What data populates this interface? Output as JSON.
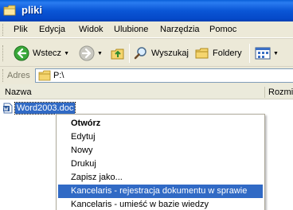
{
  "window": {
    "title": "pliki",
    "title_icon": "folder-icon"
  },
  "menubar": {
    "items": [
      "Plik",
      "Edycja",
      "Widok",
      "Ulubione",
      "Narzędzia",
      "Pomoc"
    ]
  },
  "toolbar": {
    "back_label": "Wstecz",
    "search_label": "Wyszukaj",
    "folders_label": "Foldery"
  },
  "address": {
    "label": "Adres",
    "value": "P:\\"
  },
  "columns": {
    "name": "Nazwa",
    "size": "Rozmiar"
  },
  "file": {
    "name": "Word2003.doc",
    "icon": "word-document-icon"
  },
  "context_menu": {
    "items": [
      "Otwórz",
      "Edytuj",
      "Nowy",
      "Drukuj",
      "Zapisz jako...",
      "Kancelaris - rejestracja dokumentu w sprawie",
      "Kancelaris - umieść w bazie wiedzy"
    ],
    "default_item": "Otwórz",
    "highlighted_item": "Kancelaris - rejestracja dokumentu w sprawie"
  },
  "colors": {
    "titlebar": "#0a56d6",
    "selection": "#316ac5",
    "chrome": "#ece9d8"
  }
}
